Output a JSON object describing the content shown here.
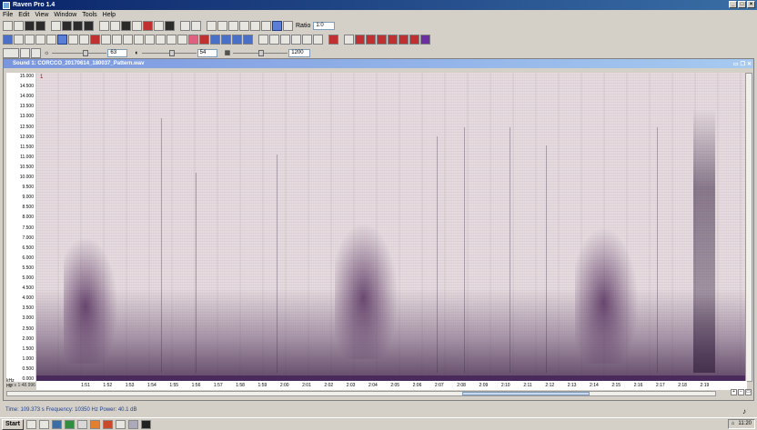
{
  "window": {
    "title": "Raven Pro 1.4"
  },
  "menu": [
    "File",
    "Edit",
    "View",
    "Window",
    "Tools",
    "Help"
  ],
  "toolbar": {
    "ratio_label": "Ratio",
    "ratio_value": "1:0",
    "brightness_value": "63",
    "contrast_value": "54",
    "size_value": "1200"
  },
  "document": {
    "title": "Sound 1: CORCCO_20170614_180037_Pattern.wav",
    "y_axis": {
      "unit": "Hz",
      "ticks": [
        "15.000",
        "14.500",
        "14.000",
        "13.500",
        "13.000",
        "12.500",
        "12.000",
        "11.500",
        "11.000",
        "10.500",
        "10.000",
        "9.500",
        "9.000",
        "8.500",
        "8.000",
        "7.500",
        "7.000",
        "6.500",
        "6.000",
        "5.500",
        "5.000",
        "4.500",
        "4.000",
        "3.500",
        "3.000",
        "2.500",
        "2.000",
        "1.500",
        "1.000",
        "0.500",
        "0.000"
      ]
    },
    "x_axis": {
      "unit": "kHz",
      "start_label": "m:s 1:48.996",
      "ticks": [
        "1:51",
        "1:52",
        "1:53",
        "1:54",
        "1:55",
        "1:56",
        "1:57",
        "1:58",
        "1:59",
        "2:00",
        "2:01",
        "2:02",
        "2:03",
        "2:04",
        "2:05",
        "2:06",
        "2:07",
        "2:08",
        "2:09",
        "2:10",
        "2:11",
        "2:12",
        "2:13",
        "2:14",
        "2:15",
        "2:16",
        "2:17",
        "2:18",
        "2:19"
      ]
    }
  },
  "status": {
    "text": "Time: 109.373 s   Frequency: 10350 Hz   Power: 40.1 dB"
  },
  "taskbar": {
    "start_label": "Start",
    "clock": "11:20"
  }
}
